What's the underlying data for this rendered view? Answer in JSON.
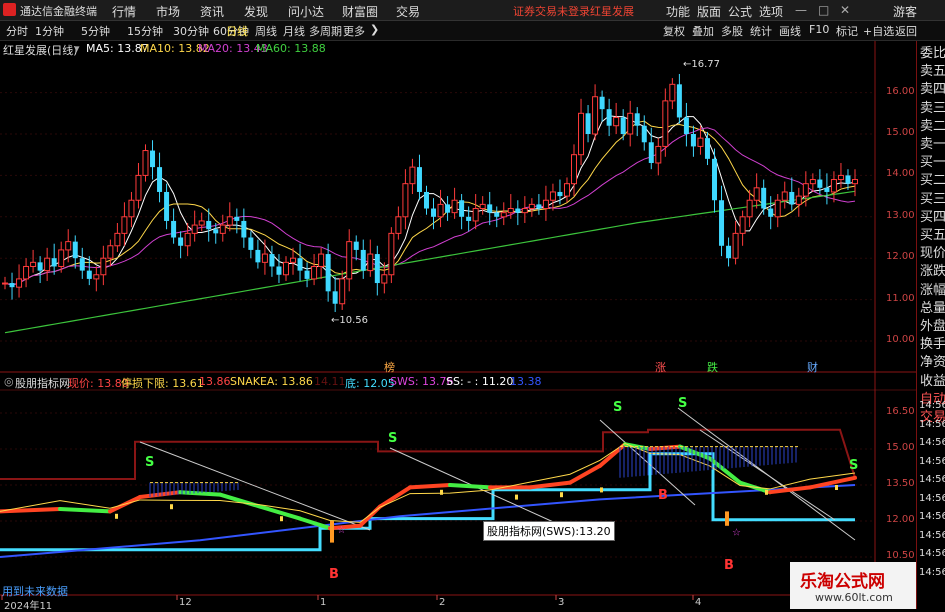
{
  "app": {
    "title": "通达信金融终端"
  },
  "menu": [
    "行情",
    "市场",
    "资讯",
    "发现",
    "问小达",
    "财富圈",
    "交易"
  ],
  "notices": [
    "证券交易未登录",
    "红星发展"
  ],
  "menu_right": [
    "功能",
    "版面",
    "公式",
    "选项",
    "游客"
  ],
  "periods": [
    "分时",
    "1分钟",
    "5分钟",
    "15分钟",
    "30分钟",
    "60分钟",
    "日线",
    "周线",
    "月线",
    "多周期",
    "更多"
  ],
  "active_period": "日线",
  "toolbar_right": [
    "复权",
    "叠加",
    "多股",
    "统计",
    "画线",
    "F10",
    "标记",
    "+自选",
    "返回"
  ],
  "price_panel": {
    "stock": "红星发展(日线)",
    "ma": [
      {
        "label": "MA5: 13.87",
        "color": "#ffffff"
      },
      {
        "label": "MA10: 13.82",
        "color": "#ffd84a"
      },
      {
        "label": "MA20: 13.43",
        "color": "#d040d0"
      },
      {
        "label": "MA60: 13.88",
        "color": "#40d040"
      }
    ],
    "high_label": "16.77",
    "low_label": "10.56",
    "y_ticks": [
      "16.00",
      "15.00",
      "14.00",
      "13.00",
      "12.00",
      "11.00",
      "10.00"
    ],
    "markers": [
      {
        "text": "榜",
        "color": "#ffaa44"
      },
      {
        "text": "涨",
        "color": "#ff5050"
      },
      {
        "text": "跌",
        "color": "#44ee44"
      },
      {
        "text": "财",
        "color": "#66aaff"
      }
    ]
  },
  "ind_panel": {
    "name": "股朋指标网",
    "fields": [
      {
        "label": "现价: 13.80",
        "color": "#ff4444"
      },
      {
        "label": "停损下限: 13.61",
        "color": "#ffd84a"
      },
      {
        "label": "13.86",
        "color": "#ff4444"
      },
      {
        "label": "SNAKEA: 13.86",
        "color": "#ffd84a"
      },
      {
        "label": "14.11",
        "color": "#661111"
      },
      {
        "label": "底: 12.05",
        "color": "#44ddff"
      },
      {
        "label": "SWS: 13.76",
        "color": "#dd44dd"
      },
      {
        "label": "SS: - : 11.20",
        "color": "#ffffff"
      },
      {
        "label": "13.38",
        "color": "#3355ff"
      }
    ],
    "y_ticks": [
      "16.50",
      "15.00",
      "13.50",
      "12.00",
      "10.50"
    ],
    "time_ticks": [
      "14:56",
      "14:56",
      "14:56",
      "14:56",
      "14:56",
      "14:56",
      "14:56",
      "14:56",
      "14:56",
      "14:56"
    ],
    "signals": [
      "S",
      "S",
      "S",
      "S",
      "S",
      "B",
      "B",
      "B"
    ],
    "tooltip": "股朋指标网(SWS):13.20"
  },
  "right_panel": [
    "委比",
    "卖五",
    "卖四",
    "卖三",
    "卖二",
    "卖一",
    "买一",
    "买二",
    "买三",
    "买四",
    "买五",
    "现价",
    "涨跌",
    "涨幅",
    "总量",
    "外盘",
    "换手",
    "净资",
    "收益",
    "自动",
    "交易"
  ],
  "x_axis": [
    "2024年11",
    "12",
    "1",
    "2",
    "3",
    "4"
  ],
  "footer": "用到未来数据",
  "watermark": {
    "title": "乐淘公式网",
    "url": "www.60lt.com"
  }
}
